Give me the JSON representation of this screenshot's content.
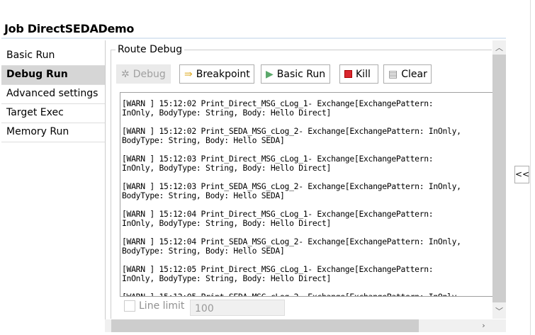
{
  "header": {
    "title": "Job DirectSEDADemo"
  },
  "nav": {
    "items": [
      {
        "label": "Basic Run"
      },
      {
        "label": "Debug Run",
        "selected": true
      },
      {
        "label": "Advanced settings"
      },
      {
        "label": "Target Exec"
      },
      {
        "label": "Memory Run"
      }
    ]
  },
  "route_debug": {
    "legend": "Route Debug",
    "buttons": {
      "debug": "Debug",
      "breakpoint": "Breakpoint",
      "basic_run": "Basic Run",
      "kill": "Kill",
      "clear": "Clear"
    },
    "log": "[WARN ] 15:12:02 Print_Direct_MSG_cLog_1- Exchange[ExchangePattern:\nInOnly, BodyType: String, Body: Hello Direct]\n\n[WARN ] 15:12:02 Print_SEDA_MSG_cLog_2- Exchange[ExchangePattern: InOnly,\nBodyType: String, Body: Hello SEDA]\n\n[WARN ] 15:12:03 Print_Direct_MSG_cLog_1- Exchange[ExchangePattern:\nInOnly, BodyType: String, Body: Hello Direct]\n\n[WARN ] 15:12:03 Print_SEDA_MSG_cLog_2- Exchange[ExchangePattern: InOnly,\nBodyType: String, Body: Hello SEDA]\n\n[WARN ] 15:12:04 Print_Direct_MSG_cLog_1- Exchange[ExchangePattern:\nInOnly, BodyType: String, Body: Hello Direct]\n\n[WARN ] 15:12:04 Print_SEDA_MSG_cLog_2- Exchange[ExchangePattern: InOnly,\nBodyType: String, Body: Hello SEDA]\n\n[WARN ] 15:12:05 Print_Direct_MSG_cLog_1- Exchange[ExchangePattern:\nInOnly, BodyType: String, Body: Hello Direct]\n\n[WARN ] 15:12:05 Print_SEDA_MSG_cLog_2- Exchange[ExchangePattern: InOnly,",
    "line_limit_label": "Line limit",
    "line_limit_checked": false,
    "line_limit_value": "100"
  },
  "collapse_label": "<<"
}
